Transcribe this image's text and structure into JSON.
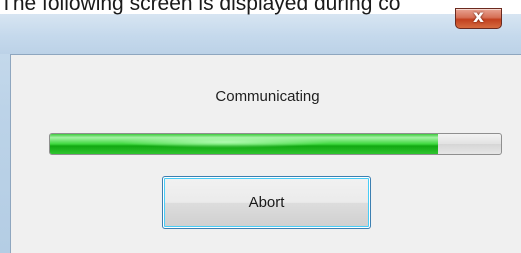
{
  "caption": "The following screen is displayed during co",
  "window": {
    "close_glyph": "x"
  },
  "dialog": {
    "status_text": "Communicating",
    "progress_percent": 86,
    "abort_label": "Abort"
  },
  "colors": {
    "progress_fill": "#2fc52f",
    "focus_ring": "#48cdf7",
    "close_button": "#c2401f"
  }
}
